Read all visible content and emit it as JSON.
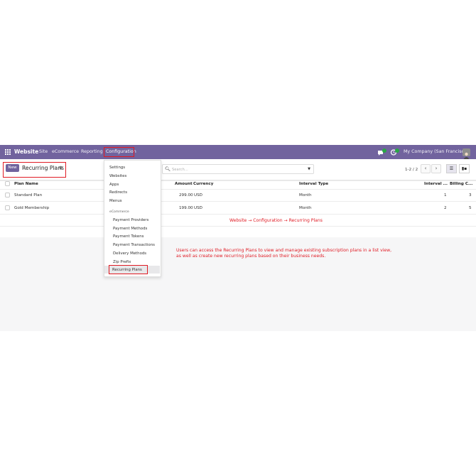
{
  "navbar": {
    "brand": "Website",
    "menus": [
      "Site",
      "eCommerce",
      "Reporting",
      "Configuration"
    ],
    "company": "My Company (San Francisco)",
    "bg_color": "#71639e"
  },
  "control": {
    "new_label": "New",
    "breadcrumb": "Recurring Plans",
    "gear_icon": "gear-icon",
    "search_placeholder": "Search...",
    "pager_text": "1-2 / 2"
  },
  "table": {
    "columns": [
      "Plan Name",
      "Amount",
      "Currency",
      "Interval Type",
      "Interval ...",
      "Billing C..."
    ],
    "rows": [
      {
        "name": "Standard Plan",
        "amount": "299.00",
        "currency": "USD",
        "interval_type": "Month",
        "interval": "1",
        "billing": "3"
      },
      {
        "name": "Gold Membership",
        "amount": "199.00",
        "currency": "USD",
        "interval_type": "Month",
        "interval": "2",
        "billing": "5"
      }
    ]
  },
  "dropdown": {
    "items": [
      "Settings",
      "Websites",
      "Apps",
      "Redirects",
      "Menus"
    ],
    "section_label": "eCommerce",
    "sub_items": [
      "Payment Providers",
      "Payment Methods",
      "Payment Tokens",
      "Payment Transactions",
      "Delivery Methods",
      "Zip Prefix",
      "Recurring Plans"
    ]
  },
  "annotations": {
    "path": "Website → Configuration → Recurring Plans",
    "desc_line1": "Users can access the Recurring Plans to view and manage existing subscription plans in a list view,",
    "desc_line2": "as well as create new recurring plans based on their business needs.",
    "color": "#e01b24"
  }
}
